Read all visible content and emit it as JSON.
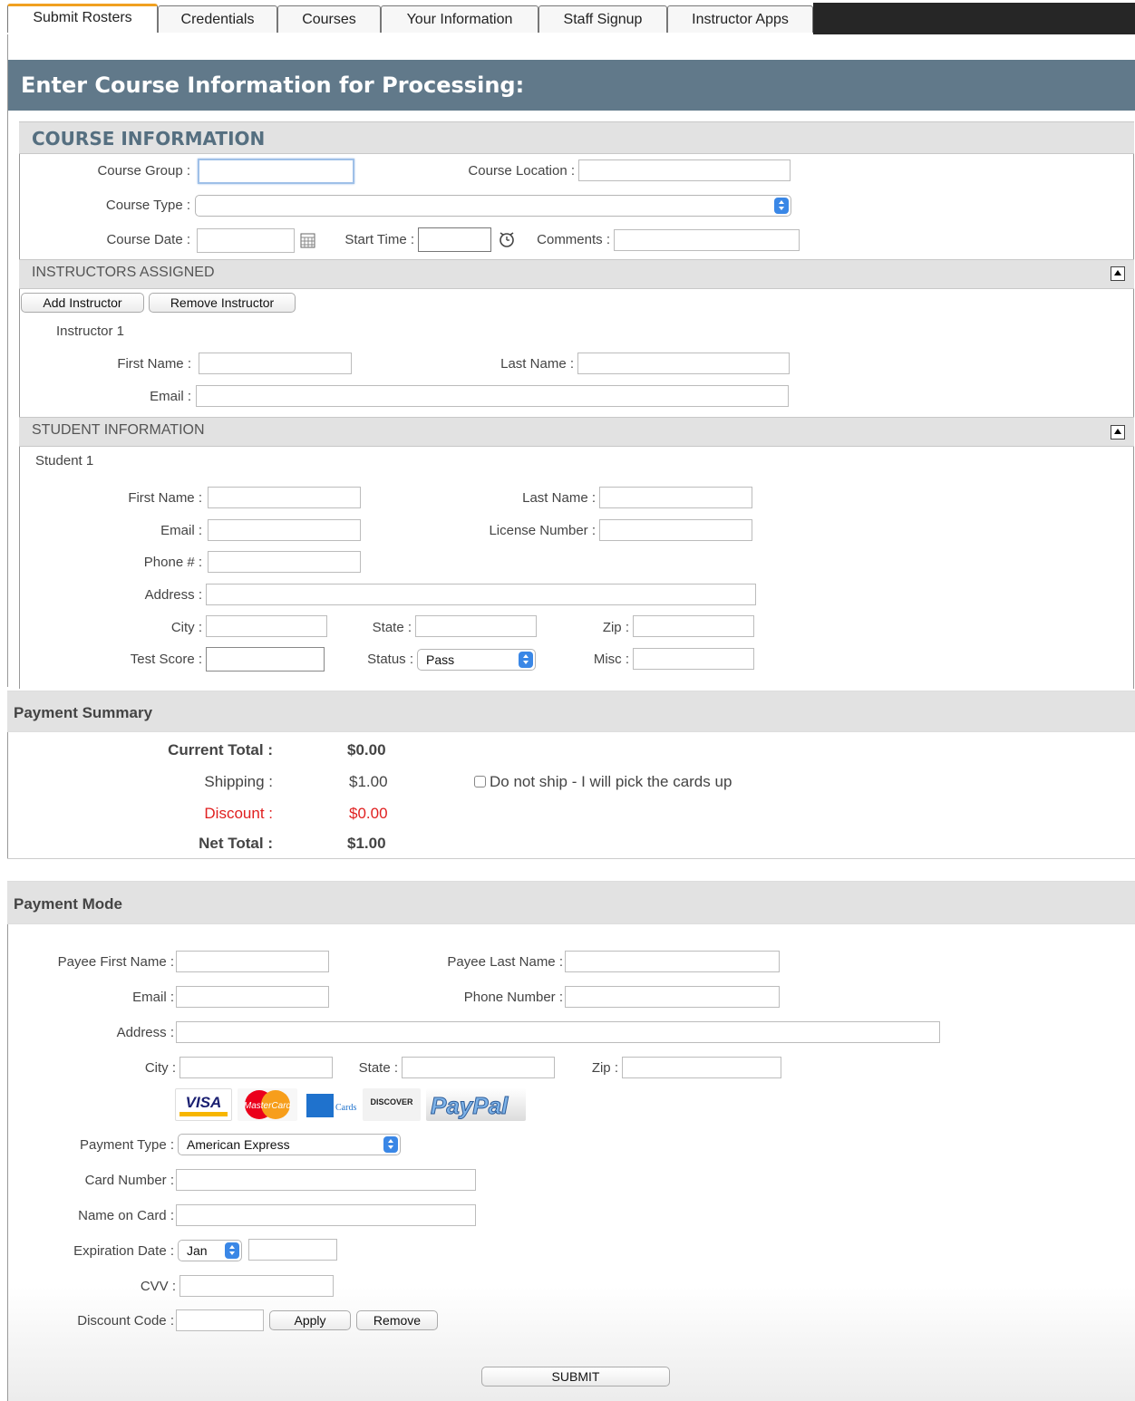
{
  "tabs": [
    "Submit Rosters",
    "Credentials",
    "Courses",
    "Your Information",
    "Staff Signup",
    "Instructor Apps"
  ],
  "page_title": "Enter Course Information for Processing:",
  "course": {
    "section_title": "COURSE INFORMATION",
    "group_label": "Course Group :",
    "location_label": "Course Location :",
    "type_label": "Course Type :",
    "date_label": "Course Date :",
    "start_time_label": "Start Time :",
    "comments_label": "Comments :"
  },
  "instructors": {
    "section_title": "INSTRUCTORS ASSIGNED",
    "add_button": "Add Instructor",
    "remove_button": "Remove Instructor",
    "item_title": "Instructor 1",
    "first_name_label": "First Name :",
    "last_name_label": "Last Name :",
    "email_label": "Email :"
  },
  "students": {
    "section_title": "STUDENT INFORMATION",
    "item_title": "Student 1",
    "first_name_label": "First Name :",
    "last_name_label": "Last Name :",
    "email_label": "Email :",
    "license_label": "License Number :",
    "phone_label": "Phone # :",
    "address_label": "Address :",
    "city_label": "City :",
    "state_label": "State :",
    "zip_label": "Zip :",
    "test_score_label": "Test Score :",
    "status_label": "Status :",
    "status_value": "Pass",
    "misc_label": "Misc :"
  },
  "summary": {
    "title": "Payment Summary",
    "current_total_label": "Current Total :",
    "current_total": "$0.00",
    "shipping_label": "Shipping :",
    "shipping": "$1.00",
    "no_ship_label": "Do not ship - I will pick the cards up",
    "discount_label": "Discount :",
    "discount": "$0.00",
    "net_total_label": "Net Total :",
    "net_total": "$1.00"
  },
  "payment": {
    "title": "Payment Mode",
    "payee_first_label": "Payee First Name :",
    "payee_last_label": "Payee Last Name :",
    "email_label": "Email :",
    "phone_label": "Phone Number :",
    "address_label": "Address :",
    "city_label": "City :",
    "state_label": "State :",
    "zip_label": "Zip :",
    "card_logos": {
      "visa": "VISA",
      "mastercard": "MasterCard",
      "amex_cards": "Cards",
      "discover": "DISCOVER",
      "paypal": "PayPal"
    },
    "type_label": "Payment Type :",
    "type_value": "American Express",
    "card_number_label": "Card Number :",
    "name_on_card_label": "Name on Card :",
    "expiration_label": "Expiration Date :",
    "exp_month": "Jan",
    "cvv_label": "CVV :",
    "discount_code_label": "Discount Code :",
    "apply_button": "Apply",
    "remove_button": "Remove",
    "submit_button": "SUBMIT"
  },
  "colors": {
    "header": "#61798a",
    "tab_accent": "#f0a020",
    "section_bg": "#e2e2e2",
    "discount_red": "#e02020"
  }
}
